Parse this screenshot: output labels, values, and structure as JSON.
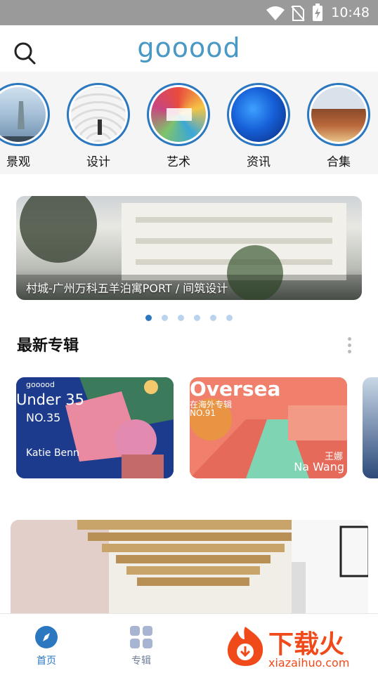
{
  "status_bar": {
    "time": "10:48"
  },
  "header": {
    "logo": "gooood",
    "search_icon": "search-icon"
  },
  "categories": [
    {
      "label": "景观"
    },
    {
      "label": "设计"
    },
    {
      "label": "艺术"
    },
    {
      "label": "资讯"
    },
    {
      "label": "合集"
    }
  ],
  "banner": {
    "caption": "村城-广州万科五羊泊寓PORT / 间筑设计",
    "dots": 6,
    "active_dot": 1
  },
  "latest": {
    "title": "最新专辑",
    "albums": [
      {
        "brand": "gooood",
        "title": "Under 35",
        "number": "NO.35",
        "name": "Katie Benn"
      },
      {
        "title": "Oversea",
        "subtitle": "在海外专辑",
        "number": "NO.91",
        "name_cn": "王娜",
        "name": "Na Wang"
      }
    ]
  },
  "tabbar": {
    "home": "首页",
    "albums": "专辑"
  },
  "watermark": {
    "brand_cn": "下载火",
    "url": "xiazaihuo.com"
  },
  "colors": {
    "accent": "#2b78c0",
    "logo": "#4a98c4"
  }
}
